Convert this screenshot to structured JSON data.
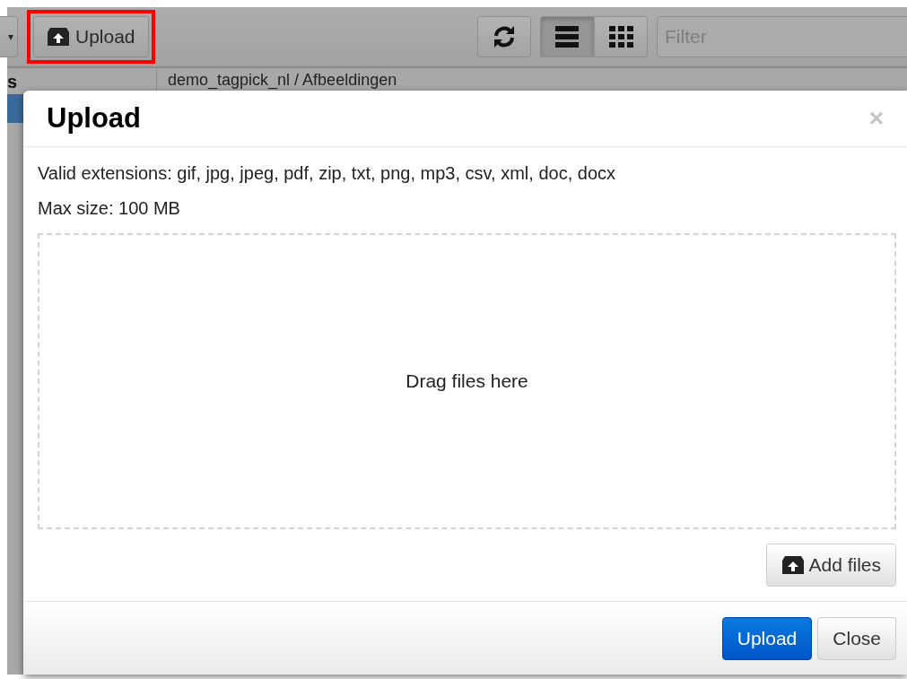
{
  "toolbar": {
    "partial_button_caret": "▾",
    "upload_button": {
      "label": "Upload",
      "highlighted": true
    },
    "view_toggle": [
      {
        "kind": "list",
        "selected": true
      },
      {
        "kind": "grid",
        "selected": false
      }
    ],
    "filter": {
      "placeholder": "Filter"
    }
  },
  "sidebar": {
    "heading": "s",
    "items": [
      {
        "selected": true
      }
    ]
  },
  "breadcrumb": "demo_tagpick_nl / Afbeeldingen",
  "dialog": {
    "title": "Upload",
    "close": "×",
    "extensions": "Valid extensions: gif, jpg, jpeg, pdf, zip, txt, png, mp3, csv, xml, doc, docx",
    "max_size": "Max size: 100 MB",
    "dropzone": "Drag files here",
    "add_files": "Add files",
    "buttons": [
      {
        "label": "Upload",
        "kind": "primary"
      },
      {
        "label": "Close",
        "kind": "default"
      }
    ]
  }
}
